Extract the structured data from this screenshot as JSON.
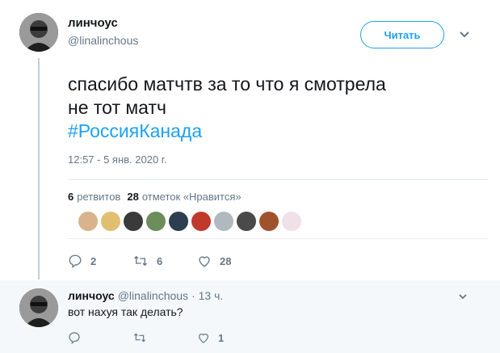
{
  "tweet": {
    "author_name": "линчоус",
    "author_handle": "@linalinchous",
    "follow_label": "Читать",
    "text_line1": "спасибо матчтв за то что я смотрела",
    "text_line2": "не тот матч",
    "hashtag": "#РоссияКанада",
    "timestamp": "12:57 - 5 янв. 2020 г.",
    "retweets_count": "6",
    "retweets_label": "ретвитов",
    "likes_count": "28",
    "likes_label": "отметок «Нравится»",
    "liker_colors": [
      "#d9b38c",
      "#e0c070",
      "#3a3a3a",
      "#6b8e5a",
      "#2c3e50",
      "#c0392b",
      "#b0b8c0",
      "#4a4a4a",
      "#a0522d",
      "#f0e0e8"
    ],
    "actions": {
      "reply_count": "2",
      "retweet_count": "6",
      "like_count": "28"
    }
  },
  "reply": {
    "author_name": "линчоус",
    "author_handle": "@linalinchous",
    "time": "· 13 ч.",
    "text": "вот нахуя так делать?",
    "actions": {
      "like_count": "1"
    }
  },
  "colors": {
    "accent": "#1da1f2",
    "muted": "#657786",
    "text": "#14171a",
    "reply_bg": "#f5f8fa"
  }
}
